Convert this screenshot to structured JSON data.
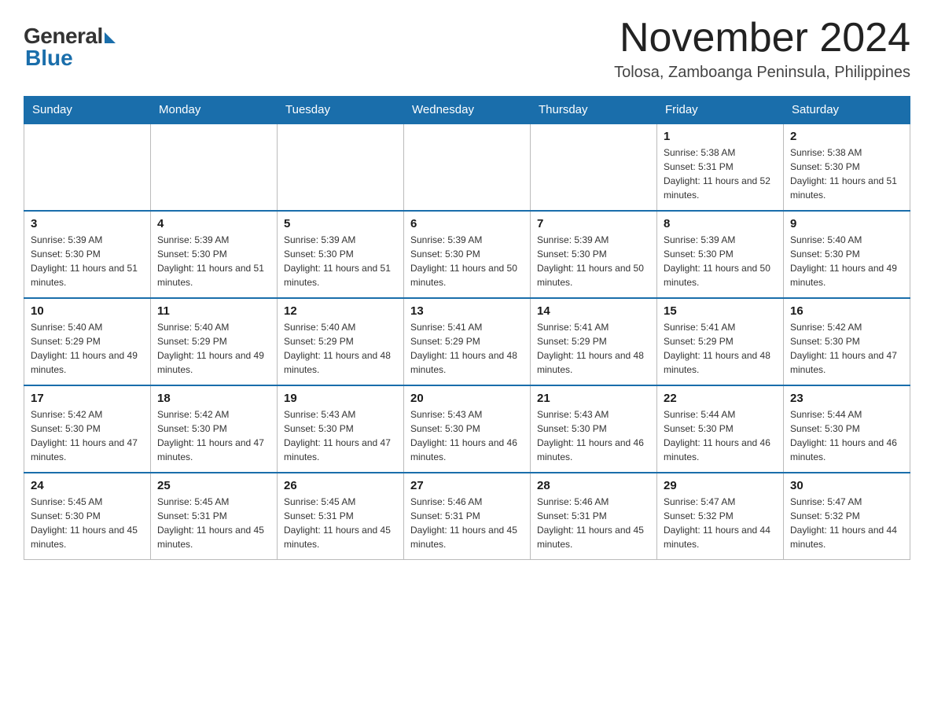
{
  "header": {
    "logo_general": "General",
    "logo_blue": "Blue",
    "month_title": "November 2024",
    "subtitle": "Tolosa, Zamboanga Peninsula, Philippines"
  },
  "weekdays": [
    "Sunday",
    "Monday",
    "Tuesday",
    "Wednesday",
    "Thursday",
    "Friday",
    "Saturday"
  ],
  "weeks": [
    [
      {
        "day": "",
        "sunrise": "",
        "sunset": "",
        "daylight": ""
      },
      {
        "day": "",
        "sunrise": "",
        "sunset": "",
        "daylight": ""
      },
      {
        "day": "",
        "sunrise": "",
        "sunset": "",
        "daylight": ""
      },
      {
        "day": "",
        "sunrise": "",
        "sunset": "",
        "daylight": ""
      },
      {
        "day": "",
        "sunrise": "",
        "sunset": "",
        "daylight": ""
      },
      {
        "day": "1",
        "sunrise": "Sunrise: 5:38 AM",
        "sunset": "Sunset: 5:31 PM",
        "daylight": "Daylight: 11 hours and 52 minutes."
      },
      {
        "day": "2",
        "sunrise": "Sunrise: 5:38 AM",
        "sunset": "Sunset: 5:30 PM",
        "daylight": "Daylight: 11 hours and 51 minutes."
      }
    ],
    [
      {
        "day": "3",
        "sunrise": "Sunrise: 5:39 AM",
        "sunset": "Sunset: 5:30 PM",
        "daylight": "Daylight: 11 hours and 51 minutes."
      },
      {
        "day": "4",
        "sunrise": "Sunrise: 5:39 AM",
        "sunset": "Sunset: 5:30 PM",
        "daylight": "Daylight: 11 hours and 51 minutes."
      },
      {
        "day": "5",
        "sunrise": "Sunrise: 5:39 AM",
        "sunset": "Sunset: 5:30 PM",
        "daylight": "Daylight: 11 hours and 51 minutes."
      },
      {
        "day": "6",
        "sunrise": "Sunrise: 5:39 AM",
        "sunset": "Sunset: 5:30 PM",
        "daylight": "Daylight: 11 hours and 50 minutes."
      },
      {
        "day": "7",
        "sunrise": "Sunrise: 5:39 AM",
        "sunset": "Sunset: 5:30 PM",
        "daylight": "Daylight: 11 hours and 50 minutes."
      },
      {
        "day": "8",
        "sunrise": "Sunrise: 5:39 AM",
        "sunset": "Sunset: 5:30 PM",
        "daylight": "Daylight: 11 hours and 50 minutes."
      },
      {
        "day": "9",
        "sunrise": "Sunrise: 5:40 AM",
        "sunset": "Sunset: 5:30 PM",
        "daylight": "Daylight: 11 hours and 49 minutes."
      }
    ],
    [
      {
        "day": "10",
        "sunrise": "Sunrise: 5:40 AM",
        "sunset": "Sunset: 5:29 PM",
        "daylight": "Daylight: 11 hours and 49 minutes."
      },
      {
        "day": "11",
        "sunrise": "Sunrise: 5:40 AM",
        "sunset": "Sunset: 5:29 PM",
        "daylight": "Daylight: 11 hours and 49 minutes."
      },
      {
        "day": "12",
        "sunrise": "Sunrise: 5:40 AM",
        "sunset": "Sunset: 5:29 PM",
        "daylight": "Daylight: 11 hours and 48 minutes."
      },
      {
        "day": "13",
        "sunrise": "Sunrise: 5:41 AM",
        "sunset": "Sunset: 5:29 PM",
        "daylight": "Daylight: 11 hours and 48 minutes."
      },
      {
        "day": "14",
        "sunrise": "Sunrise: 5:41 AM",
        "sunset": "Sunset: 5:29 PM",
        "daylight": "Daylight: 11 hours and 48 minutes."
      },
      {
        "day": "15",
        "sunrise": "Sunrise: 5:41 AM",
        "sunset": "Sunset: 5:29 PM",
        "daylight": "Daylight: 11 hours and 48 minutes."
      },
      {
        "day": "16",
        "sunrise": "Sunrise: 5:42 AM",
        "sunset": "Sunset: 5:30 PM",
        "daylight": "Daylight: 11 hours and 47 minutes."
      }
    ],
    [
      {
        "day": "17",
        "sunrise": "Sunrise: 5:42 AM",
        "sunset": "Sunset: 5:30 PM",
        "daylight": "Daylight: 11 hours and 47 minutes."
      },
      {
        "day": "18",
        "sunrise": "Sunrise: 5:42 AM",
        "sunset": "Sunset: 5:30 PM",
        "daylight": "Daylight: 11 hours and 47 minutes."
      },
      {
        "day": "19",
        "sunrise": "Sunrise: 5:43 AM",
        "sunset": "Sunset: 5:30 PM",
        "daylight": "Daylight: 11 hours and 47 minutes."
      },
      {
        "day": "20",
        "sunrise": "Sunrise: 5:43 AM",
        "sunset": "Sunset: 5:30 PM",
        "daylight": "Daylight: 11 hours and 46 minutes."
      },
      {
        "day": "21",
        "sunrise": "Sunrise: 5:43 AM",
        "sunset": "Sunset: 5:30 PM",
        "daylight": "Daylight: 11 hours and 46 minutes."
      },
      {
        "day": "22",
        "sunrise": "Sunrise: 5:44 AM",
        "sunset": "Sunset: 5:30 PM",
        "daylight": "Daylight: 11 hours and 46 minutes."
      },
      {
        "day": "23",
        "sunrise": "Sunrise: 5:44 AM",
        "sunset": "Sunset: 5:30 PM",
        "daylight": "Daylight: 11 hours and 46 minutes."
      }
    ],
    [
      {
        "day": "24",
        "sunrise": "Sunrise: 5:45 AM",
        "sunset": "Sunset: 5:30 PM",
        "daylight": "Daylight: 11 hours and 45 minutes."
      },
      {
        "day": "25",
        "sunrise": "Sunrise: 5:45 AM",
        "sunset": "Sunset: 5:31 PM",
        "daylight": "Daylight: 11 hours and 45 minutes."
      },
      {
        "day": "26",
        "sunrise": "Sunrise: 5:45 AM",
        "sunset": "Sunset: 5:31 PM",
        "daylight": "Daylight: 11 hours and 45 minutes."
      },
      {
        "day": "27",
        "sunrise": "Sunrise: 5:46 AM",
        "sunset": "Sunset: 5:31 PM",
        "daylight": "Daylight: 11 hours and 45 minutes."
      },
      {
        "day": "28",
        "sunrise": "Sunrise: 5:46 AM",
        "sunset": "Sunset: 5:31 PM",
        "daylight": "Daylight: 11 hours and 45 minutes."
      },
      {
        "day": "29",
        "sunrise": "Sunrise: 5:47 AM",
        "sunset": "Sunset: 5:32 PM",
        "daylight": "Daylight: 11 hours and 44 minutes."
      },
      {
        "day": "30",
        "sunrise": "Sunrise: 5:47 AM",
        "sunset": "Sunset: 5:32 PM",
        "daylight": "Daylight: 11 hours and 44 minutes."
      }
    ]
  ]
}
